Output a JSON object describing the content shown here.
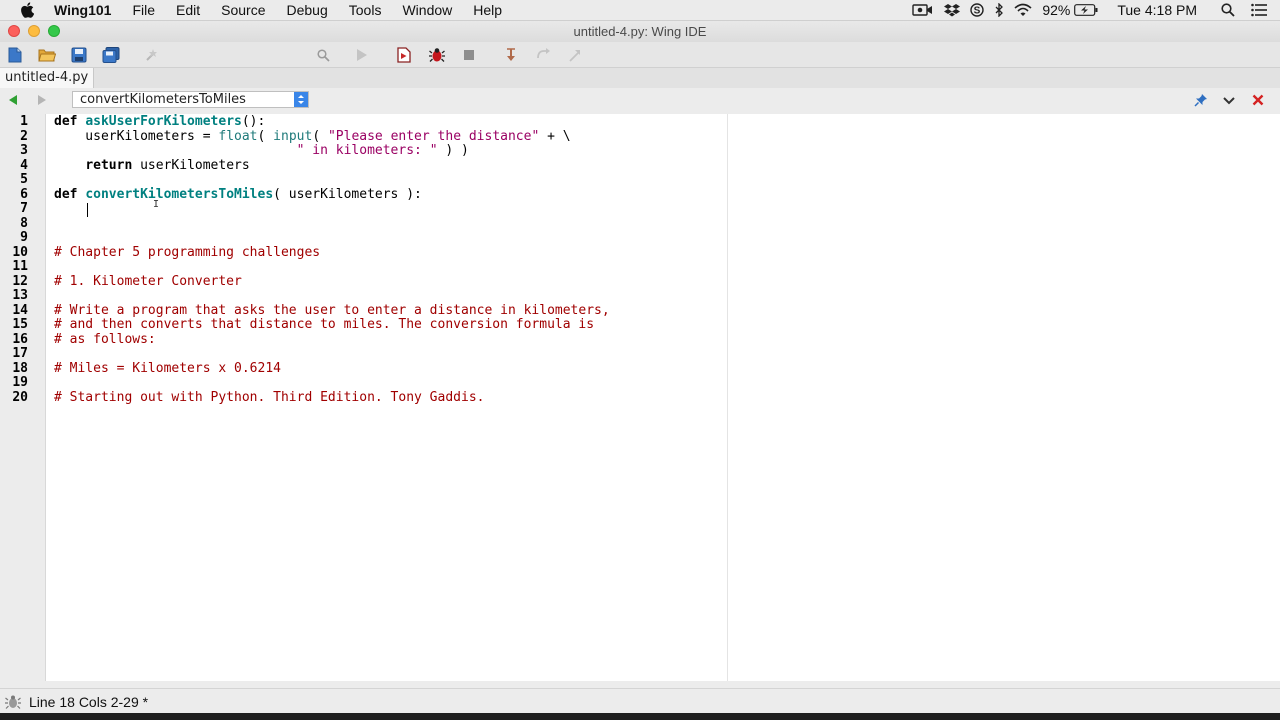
{
  "menubar": {
    "app_name": "Wing101",
    "items": [
      "File",
      "Edit",
      "Source",
      "Debug",
      "Tools",
      "Window",
      "Help"
    ],
    "status": {
      "battery": "92%",
      "clock": "Tue 4:18 PM"
    }
  },
  "window": {
    "title": "untitled-4.py: Wing IDE"
  },
  "toolbar": {
    "search_value": ""
  },
  "tabs": [
    {
      "label": "untitled-4.py",
      "active": true
    }
  ],
  "navigation": {
    "scope": "convertKilometersToMiles"
  },
  "editor": {
    "line_numbers": [
      "1",
      "2",
      "3",
      "4",
      "5",
      "6",
      "7",
      "8",
      "9",
      "10",
      "11",
      "12",
      "13",
      "14",
      "15",
      "16",
      "17",
      "18",
      "19",
      "20"
    ],
    "lines": [
      [
        {
          "t": "def ",
          "c": "kw"
        },
        {
          "t": "askUserForKilometers",
          "c": "fn"
        },
        {
          "t": "():",
          "c": ""
        }
      ],
      [
        {
          "t": "    userKilometers = ",
          "c": ""
        },
        {
          "t": "float",
          "c": "bi"
        },
        {
          "t": "( ",
          "c": ""
        },
        {
          "t": "input",
          "c": "bi"
        },
        {
          "t": "( ",
          "c": ""
        },
        {
          "t": "\"Please enter the distance\"",
          "c": "str"
        },
        {
          "t": " + \\",
          "c": ""
        }
      ],
      [
        {
          "t": "                               ",
          "c": ""
        },
        {
          "t": "\" in kilometers: \"",
          "c": "str"
        },
        {
          "t": " ) )",
          "c": ""
        }
      ],
      [
        {
          "t": "    ",
          "c": ""
        },
        {
          "t": "return",
          "c": "kw"
        },
        {
          "t": " userKilometers",
          "c": ""
        }
      ],
      [],
      [
        {
          "t": "def ",
          "c": "kw"
        },
        {
          "t": "convertKilometersToMiles",
          "c": "fn"
        },
        {
          "t": "( userKilometers ):",
          "c": ""
        }
      ],
      [
        {
          "t": "    ",
          "c": ""
        }
      ],
      [],
      [],
      [
        {
          "t": "# Chapter 5 programming challenges",
          "c": "cm"
        }
      ],
      [],
      [
        {
          "t": "# 1. Kilometer Converter",
          "c": "cm"
        }
      ],
      [],
      [
        {
          "t": "# Write a program that asks the user to enter a distance in kilometers,",
          "c": "cm"
        }
      ],
      [
        {
          "t": "# and then converts that distance to miles. The conversion formula is",
          "c": "cm"
        }
      ],
      [
        {
          "t": "# as follows:",
          "c": "cm"
        }
      ],
      [],
      [
        {
          "t": "# Miles = Kilometers x 0.6214",
          "c": "cm"
        }
      ],
      [],
      [
        {
          "t": "# Starting out with Python. Third Edition. Tony Gaddis.",
          "c": "cm"
        }
      ]
    ]
  },
  "statusbar": {
    "text": "Line 18 Cols 2-29 *"
  },
  "colors": {
    "keyword": "#000000",
    "function_name": "#008080",
    "builtin": "#1f7a7a",
    "string": "#9a0063",
    "comment": "#a00000",
    "accent": "#3a86e8"
  }
}
